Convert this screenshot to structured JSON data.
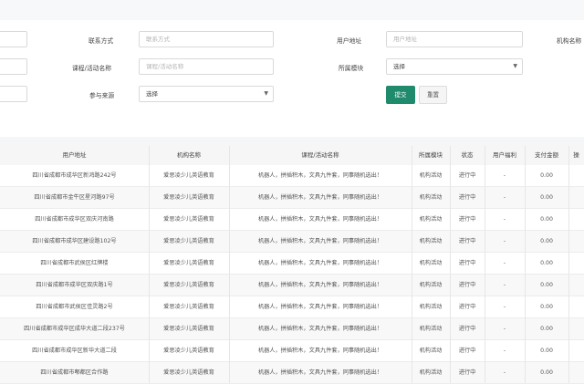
{
  "filters": {
    "contact_label": "联系方式",
    "contact_placeholder": "联系方式",
    "user_address_label": "用户地址",
    "user_address_placeholder": "用户地址",
    "org_label_partial": "机构名称",
    "course_label": "课程/活动名称",
    "course_placeholder": "课程/活动名称",
    "module_label": "所属模块",
    "module_value": "选择",
    "source_label": "参与来源",
    "source_value": "选择",
    "submit_label": "提交",
    "reset_label": "重置"
  },
  "table": {
    "headers": [
      "用户地址",
      "机构名称",
      "课程/活动名称",
      "所属模块",
      "状态",
      "用户福利",
      "支付金额",
      "操"
    ],
    "rows": [
      {
        "address": "四川省成都市成华区新鸿路242号",
        "org": "爱思凌少儿英语教育",
        "course": "机器人，拼插积木，文具九件套，同事随机选出！",
        "module": "机构活动",
        "status": "进行中",
        "benefit": "-",
        "amount": "0.00"
      },
      {
        "address": "四川省成都市金牛区星河路97号",
        "org": "爱思凌少儿英语教育",
        "course": "机器人，拼插积木，文具九件套，同事随机选出！",
        "module": "机构活动",
        "status": "进行中",
        "benefit": "-",
        "amount": "0.00"
      },
      {
        "address": "四川省成都市成华区双庆河南路",
        "org": "爱思凌少儿英语教育",
        "course": "机器人，拼插积木，文具九件套，同事随机选出！",
        "module": "机构活动",
        "status": "进行中",
        "benefit": "-",
        "amount": "0.00"
      },
      {
        "address": "四川省成都市成华区建设路102号",
        "org": "爱思凌少儿英语教育",
        "course": "机器人，拼插积木，文具九件套，同事随机选出！",
        "module": "机构活动",
        "status": "进行中",
        "benefit": "-",
        "amount": "0.00"
      },
      {
        "address": "四川省成都市武侯区红牌楼",
        "org": "爱思凌少儿英语教育",
        "course": "机器人，拼插积木，文具九件套，同事随机选出！",
        "module": "机构活动",
        "status": "进行中",
        "benefit": "-",
        "amount": "0.00"
      },
      {
        "address": "四川省成都市成华区双庆路1号",
        "org": "爱思凌少儿英语教育",
        "course": "机器人，拼插积木，文具九件套，同事随机选出！",
        "module": "机构活动",
        "status": "进行中",
        "benefit": "-",
        "amount": "0.00"
      },
      {
        "address": "四川省成都市武侯区佳灵路2号",
        "org": "爱思凌少儿英语教育",
        "course": "机器人，拼插积木，文具九件套，同事随机选出！",
        "module": "机构活动",
        "status": "进行中",
        "benefit": "-",
        "amount": "0.00"
      },
      {
        "address": "四川省成都市成华区成华大道二段237号",
        "org": "爱思凌少儿英语教育",
        "course": "机器人，拼插积木，文具九件套，同事随机选出！",
        "module": "机构活动",
        "status": "进行中",
        "benefit": "-",
        "amount": "0.00"
      },
      {
        "address": "四川省成都市成华区新华大道二段",
        "org": "爱思凌少儿英语教育",
        "course": "机器人，拼插积木，文具九件套，同事随机选出！",
        "module": "机构活动",
        "status": "进行中",
        "benefit": "-",
        "amount": "0.00"
      },
      {
        "address": "四川省成都市郫都区合作路",
        "org": "爱思凌少儿英语教育",
        "course": "机器人，拼插积木，文具九件套，同事随机选出！",
        "module": "机构活动",
        "status": "进行中",
        "benefit": "-",
        "amount": "0.00"
      }
    ]
  }
}
